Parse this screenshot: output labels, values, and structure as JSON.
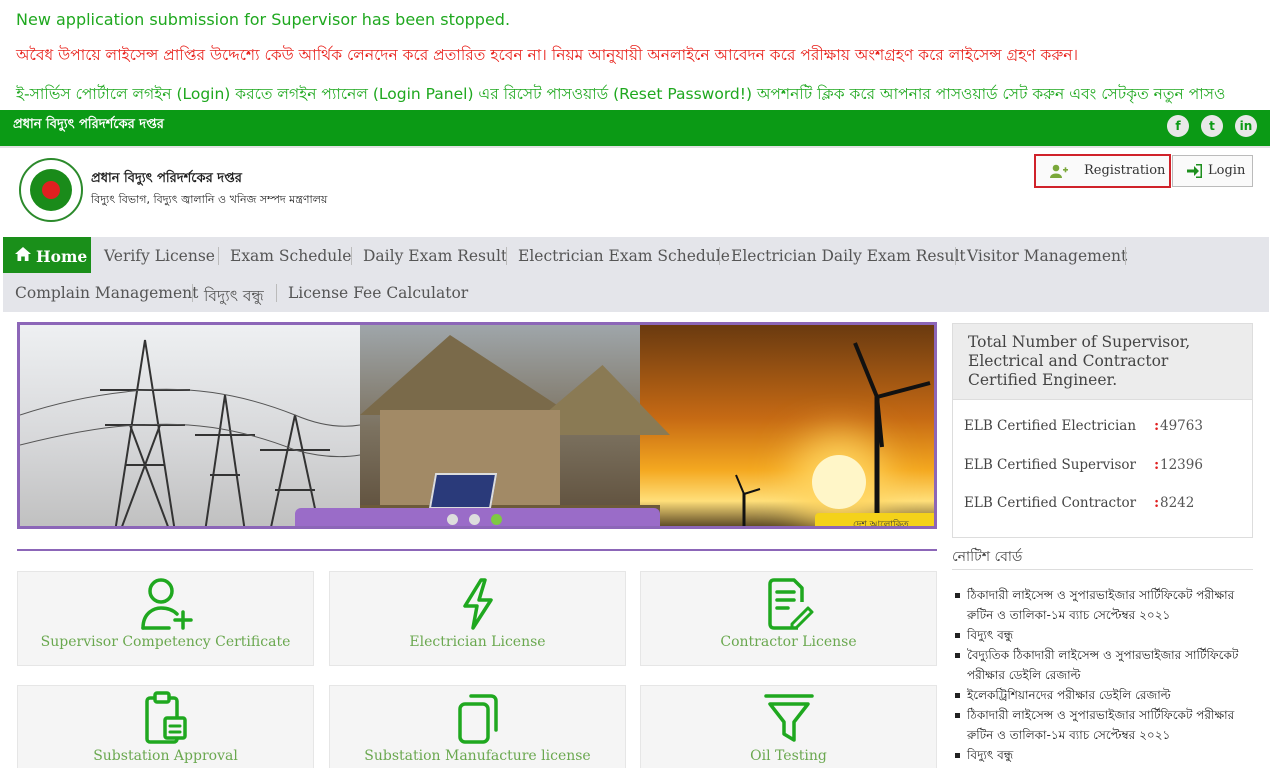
{
  "announcements": {
    "line1": "New application submission for Supervisor has been stopped.",
    "line2": "অবৈধ উপায়ে লাইসেন্স প্রাপ্তির উদ্দেশ্যে কেউ আর্থিক লেনদেন করে প্রতারিত হবেন না। নিয়ম আনুযায়ী অনলাইনে আবেদন করে পরীক্ষায় অংশগ্রহণ করে লাইসেন্স গ্রহণ করুন।",
    "line3": "ই-সার্ভিস পোর্টালে লগইন (Login) করতে লগইন প্যানেল (Login Panel) এর রিসেট পাসওয়ার্ড (Reset Password!) অপশনটি ক্লিক করে আপনার পাসওয়ার্ড সেট করুন এবং সেটকৃত নতুন পাসও"
  },
  "topbar": {
    "office_name": "প্রধান বিদ্যুৎ পরিদর্শকের দপ্তর",
    "social": [
      "f",
      "t",
      "in"
    ],
    "color": "#0b9a15"
  },
  "header": {
    "name": "প্রধান বিদ্যুৎ পরিদর্শকের দপ্তর",
    "ministry": "বিদ্যুৎ বিভাগ, বিদ্যুৎ জ্বালানি ও খনিজ সম্পদ মন্ত্রণালয়",
    "registration_label": "Registration",
    "login_label": "Login"
  },
  "nav": {
    "home": "Home",
    "items": [
      "Verify License",
      "Exam Schedule",
      "Daily Exam Result",
      "Electrician Exam Schedule",
      "Electrician Daily Exam Result",
      "Visitor Management",
      "Complain Management",
      "বিদ্যুৎ বন্ধু",
      "License Fee Calculator"
    ]
  },
  "slider": {
    "active_slide": 3,
    "slides": 3,
    "badge": "দেশ আলোকিত"
  },
  "stats": {
    "title": "Total Number of Supervisor, Electrical and Contractor Certified Engineer.",
    "rows": [
      {
        "label": "ELB Certified Electrician",
        "value": "49763"
      },
      {
        "label": "ELB Certified Supervisor",
        "value": "12396"
      },
      {
        "label": "ELB Certified Contractor",
        "value": "8242"
      }
    ]
  },
  "notice": {
    "title": "নোটিশ বোর্ড",
    "items": [
      "ঠিকাদারী লাইসেন্স ও সুপারভাইজার সার্টিফিকেট পরীক্ষার রুটিন ও তালিকা-১ম ব্যাচ সেপ্টেম্বর ২০২১",
      "বিদ্যুৎ বন্ধু",
      "বৈদ্যুতিক ঠিকাদারী লাইসেন্স ও সুপারভাইজার সার্টিফিকেট পরীক্ষার ডেইলি রেজাল্ট",
      "ইলেকট্রিশিয়ানদের পরীক্ষার ডেইলি রেজাল্ট",
      "ঠিকাদারী লাইসেন্স ও সুপারভাইজার সার্টিফিকেট পরীক্ষার রুটিন ও তালিকা-১ম ব্যাচ সেপ্টেম্বর ২০২১",
      "বিদ্যুৎ বন্ধু"
    ]
  },
  "services": [
    {
      "label": "Supervisor Competency Certificate",
      "icon": "user-plus-icon"
    },
    {
      "label": "Electrician License",
      "icon": "lightning-icon"
    },
    {
      "label": "Contractor License",
      "icon": "document-edit-icon"
    },
    {
      "label": "Substation Approval",
      "icon": "clipboard-icon"
    },
    {
      "label": "Substation Manufacture license",
      "icon": "copy-icon"
    },
    {
      "label": "Oil Testing",
      "icon": "filter-icon"
    }
  ],
  "colors": {
    "brand_green": "#1a8f1a",
    "accent_purple": "#8c66b8",
    "highlight_red": "#d0222a",
    "service_label": "#6aa84f"
  }
}
